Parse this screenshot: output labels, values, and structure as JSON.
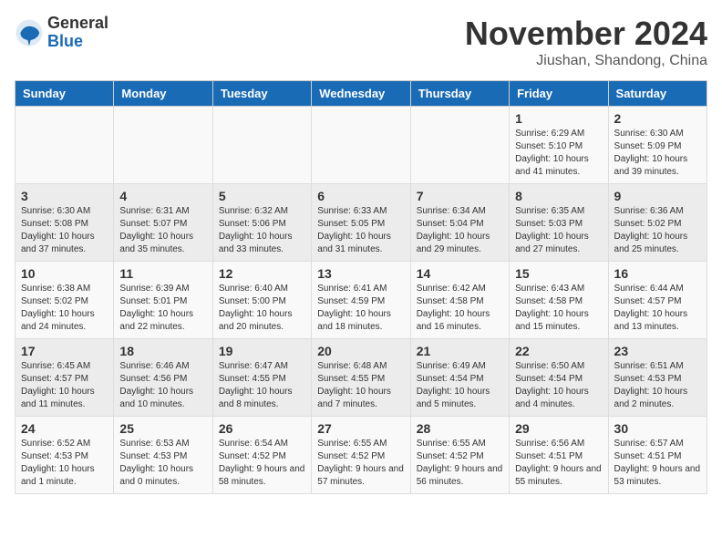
{
  "header": {
    "logo_general": "General",
    "logo_blue": "Blue",
    "title": "November 2024",
    "location": "Jiushan, Shandong, China"
  },
  "days_of_week": [
    "Sunday",
    "Monday",
    "Tuesday",
    "Wednesday",
    "Thursday",
    "Friday",
    "Saturday"
  ],
  "weeks": [
    [
      {
        "day": "",
        "info": ""
      },
      {
        "day": "",
        "info": ""
      },
      {
        "day": "",
        "info": ""
      },
      {
        "day": "",
        "info": ""
      },
      {
        "day": "",
        "info": ""
      },
      {
        "day": "1",
        "info": "Sunrise: 6:29 AM\nSunset: 5:10 PM\nDaylight: 10 hours and 41 minutes."
      },
      {
        "day": "2",
        "info": "Sunrise: 6:30 AM\nSunset: 5:09 PM\nDaylight: 10 hours and 39 minutes."
      }
    ],
    [
      {
        "day": "3",
        "info": "Sunrise: 6:30 AM\nSunset: 5:08 PM\nDaylight: 10 hours and 37 minutes."
      },
      {
        "day": "4",
        "info": "Sunrise: 6:31 AM\nSunset: 5:07 PM\nDaylight: 10 hours and 35 minutes."
      },
      {
        "day": "5",
        "info": "Sunrise: 6:32 AM\nSunset: 5:06 PM\nDaylight: 10 hours and 33 minutes."
      },
      {
        "day": "6",
        "info": "Sunrise: 6:33 AM\nSunset: 5:05 PM\nDaylight: 10 hours and 31 minutes."
      },
      {
        "day": "7",
        "info": "Sunrise: 6:34 AM\nSunset: 5:04 PM\nDaylight: 10 hours and 29 minutes."
      },
      {
        "day": "8",
        "info": "Sunrise: 6:35 AM\nSunset: 5:03 PM\nDaylight: 10 hours and 27 minutes."
      },
      {
        "day": "9",
        "info": "Sunrise: 6:36 AM\nSunset: 5:02 PM\nDaylight: 10 hours and 25 minutes."
      }
    ],
    [
      {
        "day": "10",
        "info": "Sunrise: 6:38 AM\nSunset: 5:02 PM\nDaylight: 10 hours and 24 minutes."
      },
      {
        "day": "11",
        "info": "Sunrise: 6:39 AM\nSunset: 5:01 PM\nDaylight: 10 hours and 22 minutes."
      },
      {
        "day": "12",
        "info": "Sunrise: 6:40 AM\nSunset: 5:00 PM\nDaylight: 10 hours and 20 minutes."
      },
      {
        "day": "13",
        "info": "Sunrise: 6:41 AM\nSunset: 4:59 PM\nDaylight: 10 hours and 18 minutes."
      },
      {
        "day": "14",
        "info": "Sunrise: 6:42 AM\nSunset: 4:58 PM\nDaylight: 10 hours and 16 minutes."
      },
      {
        "day": "15",
        "info": "Sunrise: 6:43 AM\nSunset: 4:58 PM\nDaylight: 10 hours and 15 minutes."
      },
      {
        "day": "16",
        "info": "Sunrise: 6:44 AM\nSunset: 4:57 PM\nDaylight: 10 hours and 13 minutes."
      }
    ],
    [
      {
        "day": "17",
        "info": "Sunrise: 6:45 AM\nSunset: 4:57 PM\nDaylight: 10 hours and 11 minutes."
      },
      {
        "day": "18",
        "info": "Sunrise: 6:46 AM\nSunset: 4:56 PM\nDaylight: 10 hours and 10 minutes."
      },
      {
        "day": "19",
        "info": "Sunrise: 6:47 AM\nSunset: 4:55 PM\nDaylight: 10 hours and 8 minutes."
      },
      {
        "day": "20",
        "info": "Sunrise: 6:48 AM\nSunset: 4:55 PM\nDaylight: 10 hours and 7 minutes."
      },
      {
        "day": "21",
        "info": "Sunrise: 6:49 AM\nSunset: 4:54 PM\nDaylight: 10 hours and 5 minutes."
      },
      {
        "day": "22",
        "info": "Sunrise: 6:50 AM\nSunset: 4:54 PM\nDaylight: 10 hours and 4 minutes."
      },
      {
        "day": "23",
        "info": "Sunrise: 6:51 AM\nSunset: 4:53 PM\nDaylight: 10 hours and 2 minutes."
      }
    ],
    [
      {
        "day": "24",
        "info": "Sunrise: 6:52 AM\nSunset: 4:53 PM\nDaylight: 10 hours and 1 minute."
      },
      {
        "day": "25",
        "info": "Sunrise: 6:53 AM\nSunset: 4:53 PM\nDaylight: 10 hours and 0 minutes."
      },
      {
        "day": "26",
        "info": "Sunrise: 6:54 AM\nSunset: 4:52 PM\nDaylight: 9 hours and 58 minutes."
      },
      {
        "day": "27",
        "info": "Sunrise: 6:55 AM\nSunset: 4:52 PM\nDaylight: 9 hours and 57 minutes."
      },
      {
        "day": "28",
        "info": "Sunrise: 6:55 AM\nSunset: 4:52 PM\nDaylight: 9 hours and 56 minutes."
      },
      {
        "day": "29",
        "info": "Sunrise: 6:56 AM\nSunset: 4:51 PM\nDaylight: 9 hours and 55 minutes."
      },
      {
        "day": "30",
        "info": "Sunrise: 6:57 AM\nSunset: 4:51 PM\nDaylight: 9 hours and 53 minutes."
      }
    ]
  ]
}
